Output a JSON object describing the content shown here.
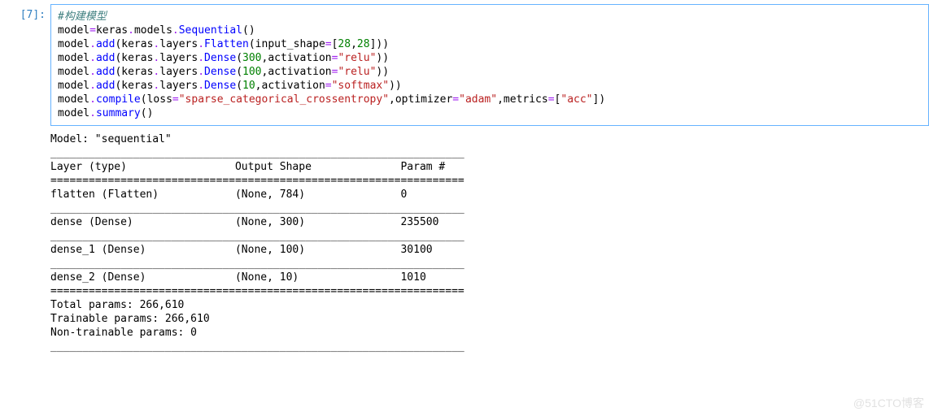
{
  "cell": {
    "prompt": "[7]:",
    "code": {
      "l1_comment": "#构建模型",
      "l2": {
        "a": "model",
        "op": "=",
        "b": "keras",
        "c": "models",
        "d": "Sequential",
        "paren": "()"
      },
      "l3": {
        "a": "model",
        "m": "add",
        "b": "keras",
        "c": "layers",
        "d": "Flatten",
        "kw": "input_shape",
        "op": "=",
        "lb": "[",
        "n1": "28",
        "comma": ",",
        "n2": "28",
        "rb": "]))"
      },
      "l4": {
        "a": "model",
        "m": "add",
        "b": "keras",
        "c": "layers",
        "d": "Dense",
        "n": "300",
        "comma": ",",
        "kw": "activation",
        "op": "=",
        "s": "\"relu\"",
        "end": "))"
      },
      "l5": {
        "a": "model",
        "m": "add",
        "b": "keras",
        "c": "layers",
        "d": "Dense",
        "n": "100",
        "comma": ",",
        "kw": "activation",
        "op": "=",
        "s": "\"relu\"",
        "end": "))"
      },
      "l6": {
        "a": "model",
        "m": "add",
        "b": "keras",
        "c": "layers",
        "d": "Dense",
        "n": "10",
        "comma": ",",
        "kw": "activation",
        "op": "=",
        "s": "\"softmax\"",
        "end": "))"
      },
      "l7": {
        "a": "model",
        "m": "compile",
        "kw1": "loss",
        "op": "=",
        "s1": "\"sparse_categorical_crossentropy\"",
        "c1": ",",
        "kw2": "optimizer",
        "s2": "\"adam\"",
        "c2": ",",
        "kw3": "metrics",
        "lb": "[",
        "s3": "\"acc\"",
        "rb": "])"
      },
      "l8": {
        "a": "model",
        "m": "summary",
        "paren": "()"
      }
    }
  },
  "output": {
    "model_name_line": "Model: \"sequential\"",
    "divider_under": "_________________________________________________________________",
    "header": "Layer (type)                 Output Shape              Param #   ",
    "divider_eq": "=================================================================",
    "rows": [
      "flatten (Flatten)            (None, 784)               0         ",
      "dense (Dense)                (None, 300)               235500    ",
      "dense_1 (Dense)              (None, 100)               30100     ",
      "dense_2 (Dense)              (None, 10)                1010      "
    ],
    "totals": {
      "total": "Total params: 266,610",
      "trainable": "Trainable params: 266,610",
      "nontrainable": "Non-trainable params: 0"
    }
  },
  "model_summary_data": {
    "model_name": "sequential",
    "layers": [
      {
        "name": "flatten",
        "type": "Flatten",
        "output_shape": "(None, 784)",
        "params": 0
      },
      {
        "name": "dense",
        "type": "Dense",
        "output_shape": "(None, 300)",
        "params": 235500
      },
      {
        "name": "dense_1",
        "type": "Dense",
        "output_shape": "(None, 100)",
        "params": 30100
      },
      {
        "name": "dense_2",
        "type": "Dense",
        "output_shape": "(None, 10)",
        "params": 1010
      }
    ],
    "total_params": 266610,
    "trainable_params": 266610,
    "non_trainable_params": 0
  },
  "watermark": "@51CTO博客"
}
